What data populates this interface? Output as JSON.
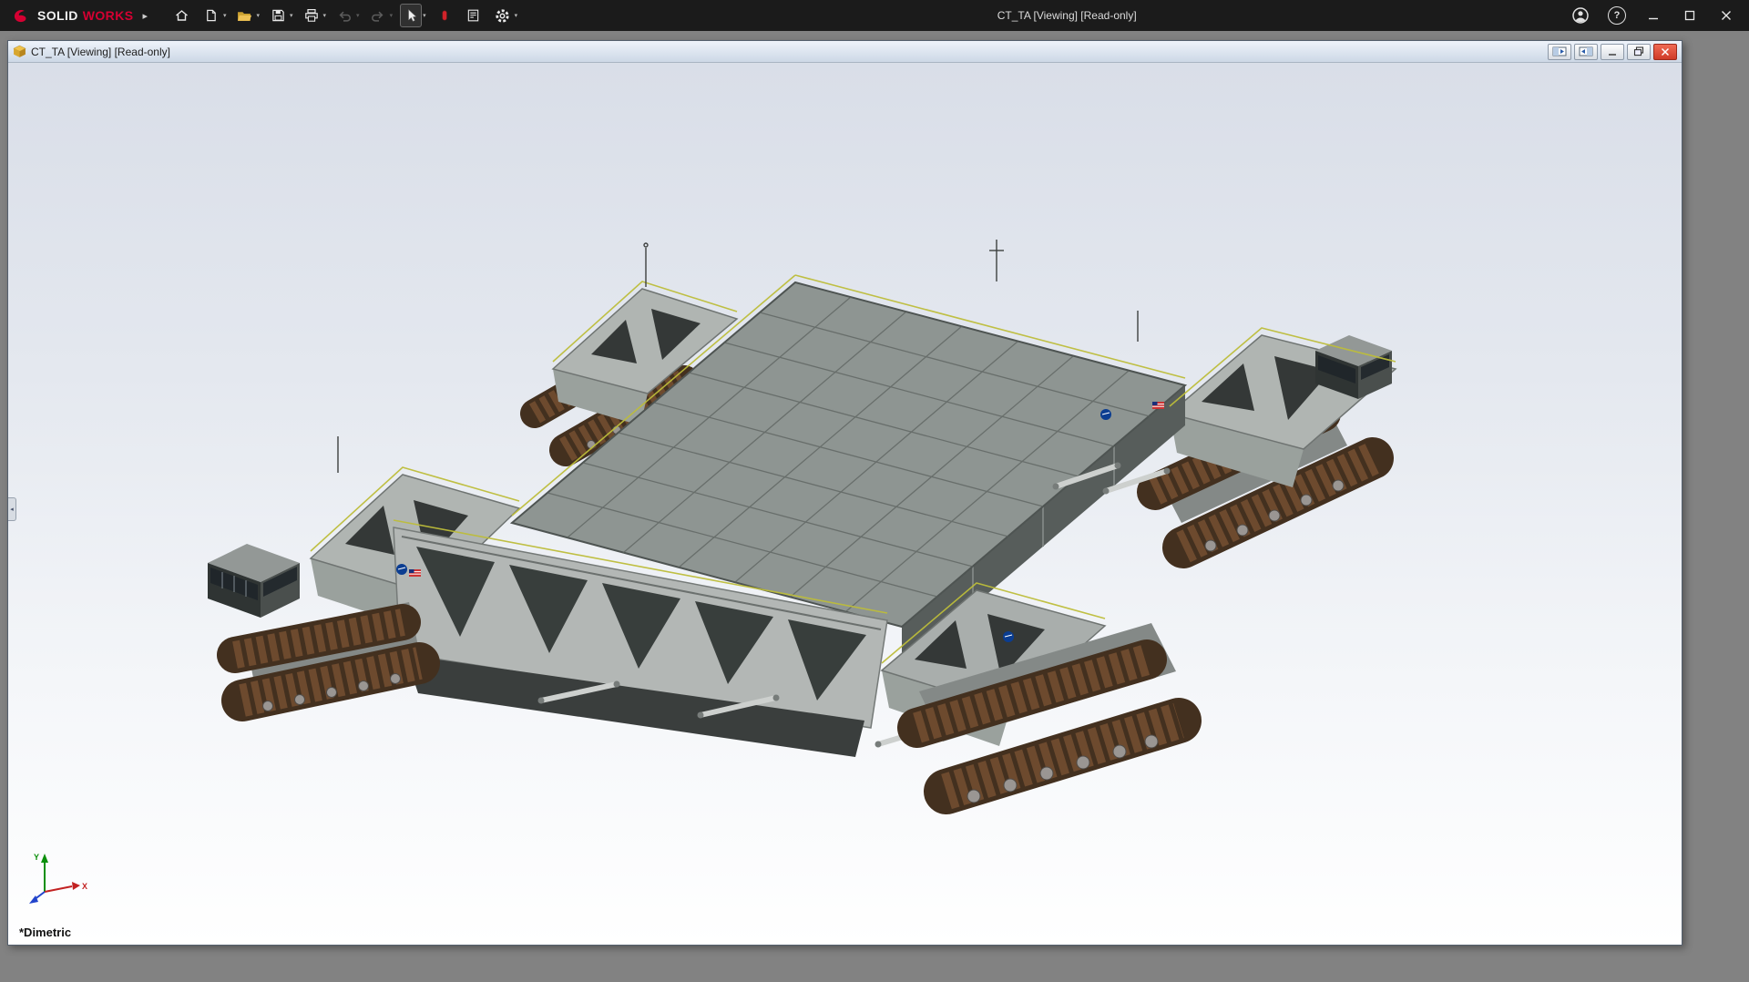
{
  "app": {
    "titlebar": {
      "brand_primary": "SOLID",
      "brand_secondary": "WORKS",
      "document_title": "CT_TA [Viewing] [Read-only]"
    },
    "toolbar_icons": [
      "home-icon",
      "new-document-icon",
      "open-document-icon",
      "save-icon",
      "print-icon",
      "undo-icon",
      "redo-icon",
      "select-cursor-icon",
      "record-icon",
      "property-tab-icon",
      "settings-gear-icon"
    ],
    "window_icons": [
      "account-icon",
      "help-icon",
      "minimize-icon",
      "maximize-icon",
      "close-icon"
    ]
  },
  "glyphs": {
    "flyout_arrow": "▸",
    "dropdown_caret": "▾",
    "collapse_arrow": "◂",
    "question_mark": "?"
  },
  "document_window": {
    "title": "CT_TA [Viewing] [Read-only]",
    "controls": [
      "pane-left-icon",
      "pane-right-icon",
      "minimize-icon",
      "restore-icon",
      "close-icon"
    ]
  },
  "viewport": {
    "orientation_label": "*Dimetric",
    "triad": {
      "x_label": "X",
      "y_label": "Y"
    },
    "model_name": "crawler-transporter-assembly"
  },
  "colors": {
    "titlebar_bg": "#1b1b1b",
    "mdi_bg": "#828282",
    "brand_red": "#d50032",
    "close_red": "#cf3a28",
    "deck_gray": "#8e9592",
    "track_brown": "#6d4a2e",
    "railing_yellow": "#bdbd3a",
    "nasa_blue": "#0b3d91",
    "viewport_top": "#d9dee8",
    "viewport_bottom": "#ffffff"
  }
}
